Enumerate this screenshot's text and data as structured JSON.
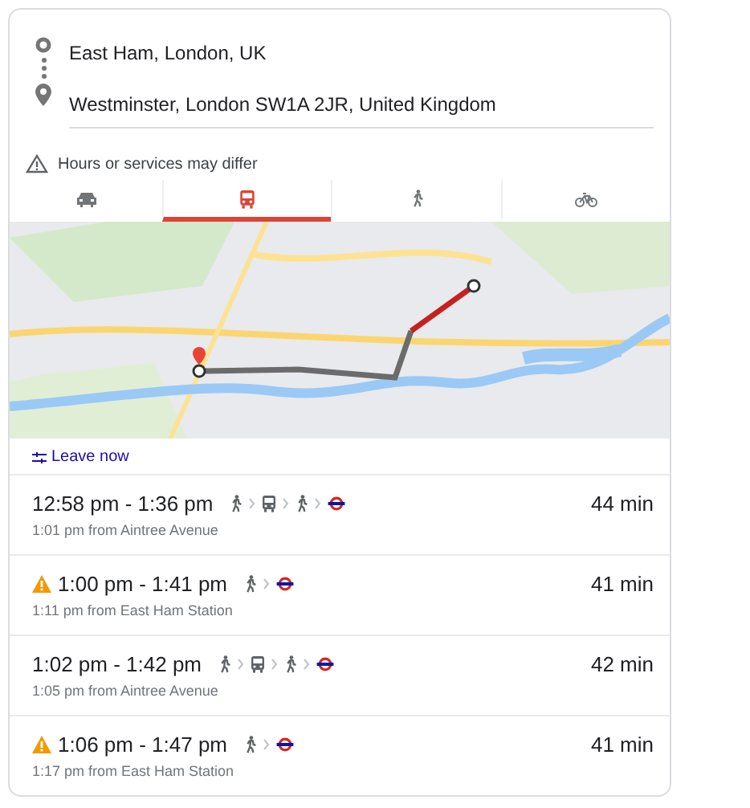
{
  "origin": "East Ham, London, UK",
  "destination": "Westminster, London SW1A 2JR, United Kingdom",
  "notice": "Hours or services may differ",
  "tabs": [
    {
      "kind": "car",
      "selected": false
    },
    {
      "kind": "transit",
      "selected": true
    },
    {
      "kind": "walk",
      "selected": false
    },
    {
      "kind": "bike",
      "selected": false
    }
  ],
  "leave_option": "Leave now",
  "routes": [
    {
      "alert": false,
      "times": "12:58 pm - 1:36 pm",
      "steps": [
        {
          "kind": "walk"
        },
        {
          "kind": "bus"
        },
        {
          "kind": "walk"
        },
        {
          "kind": "tube"
        }
      ],
      "duration": "44 min",
      "departure": "1:01 pm from Aintree Avenue"
    },
    {
      "alert": true,
      "times": "1:00 pm - 1:41 pm",
      "steps": [
        {
          "kind": "walk"
        },
        {
          "kind": "tube"
        }
      ],
      "duration": "41 min",
      "departure": "1:11 pm from East Ham Station"
    },
    {
      "alert": false,
      "times": "1:02 pm - 1:42 pm",
      "steps": [
        {
          "kind": "walk"
        },
        {
          "kind": "bus"
        },
        {
          "kind": "walk"
        },
        {
          "kind": "tube"
        }
      ],
      "duration": "42 min",
      "departure": "1:05 pm from Aintree Avenue"
    },
    {
      "alert": true,
      "times": "1:06 pm - 1:47 pm",
      "steps": [
        {
          "kind": "walk"
        },
        {
          "kind": "tube"
        }
      ],
      "duration": "41 min",
      "departure": "1:17 pm from East Ham Station"
    }
  ]
}
